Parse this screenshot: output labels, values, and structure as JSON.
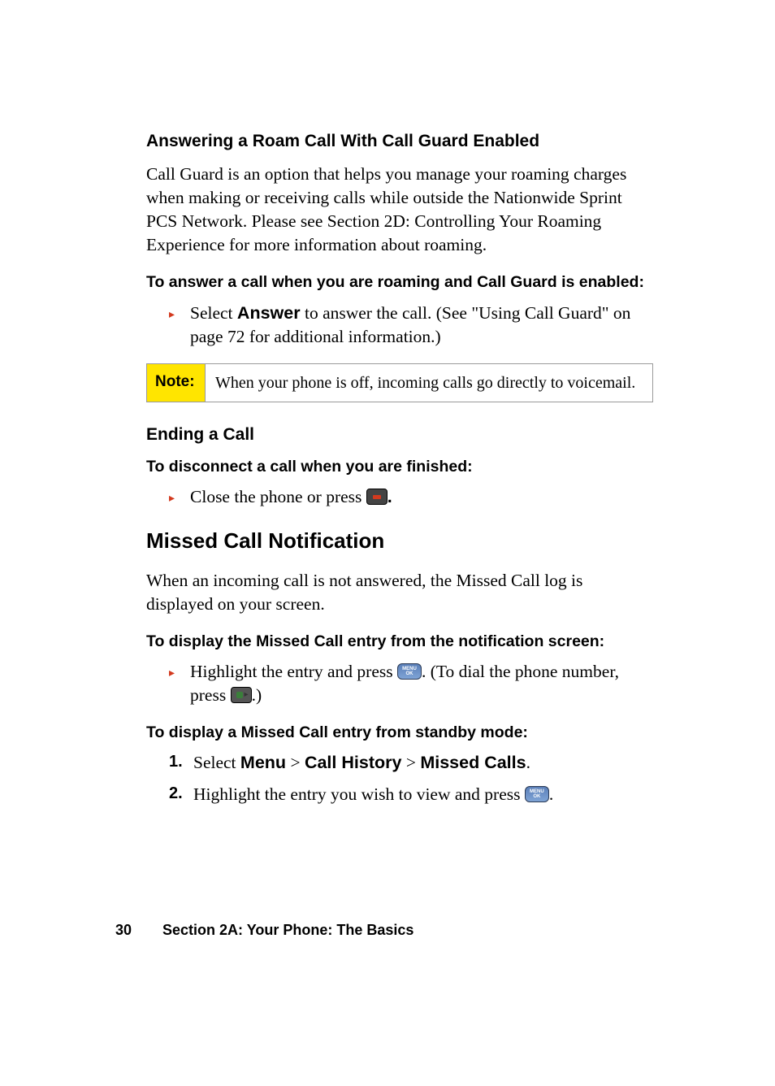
{
  "sec1": {
    "heading": "Answering a Roam Call With Call Guard Enabled",
    "para": "Call Guard is an option that helps you manage your roaming charges when making or receiving calls while outside the Nationwide Sprint PCS Network. Please see Section 2D: Controlling Your Roaming Experience for more information about roaming.",
    "lead": "To answer a call when you are roaming and Call Guard is enabled:",
    "bullet_pre": "Select ",
    "bullet_bold": "Answer",
    "bullet_post": " to answer the call. (See \"Using Call Guard\" on page 72 for additional information.)"
  },
  "note": {
    "label": "Note:",
    "text": "When your phone is off, incoming calls go directly to voicemail."
  },
  "sec2": {
    "heading": "Ending a Call",
    "lead": "To disconnect a call when you are finished:",
    "bullet_text": "Close the phone or press ",
    "bullet_tail": "."
  },
  "sec3": {
    "heading": "Missed Call Notification",
    "para": "When an incoming call is not answered, the Missed Call log is displayed on your screen.",
    "lead1": "To display the Missed Call entry from the notification screen:",
    "b1_pre": "Highlight the entry and press ",
    "b1_mid": ". (To dial the phone number, press ",
    "b1_post": ".)",
    "lead2": "To display a Missed Call entry from standby mode:",
    "step1_pre": "Select ",
    "step1_m1": "Menu",
    "step1_gt1": " > ",
    "step1_m2": "Call History",
    "step1_gt2": " > ",
    "step1_m3": "Missed Calls",
    "step1_post": ".",
    "step2_pre": "Highlight the entry you wish to view and press ",
    "step2_post": "."
  },
  "icons": {
    "menu_ok_line1": "MENU",
    "menu_ok_line2": "OK"
  },
  "footer": {
    "page": "30",
    "section": "Section 2A: Your Phone: The Basics"
  },
  "markers": {
    "arrow": "▸",
    "num1": "1.",
    "num2": "2."
  }
}
